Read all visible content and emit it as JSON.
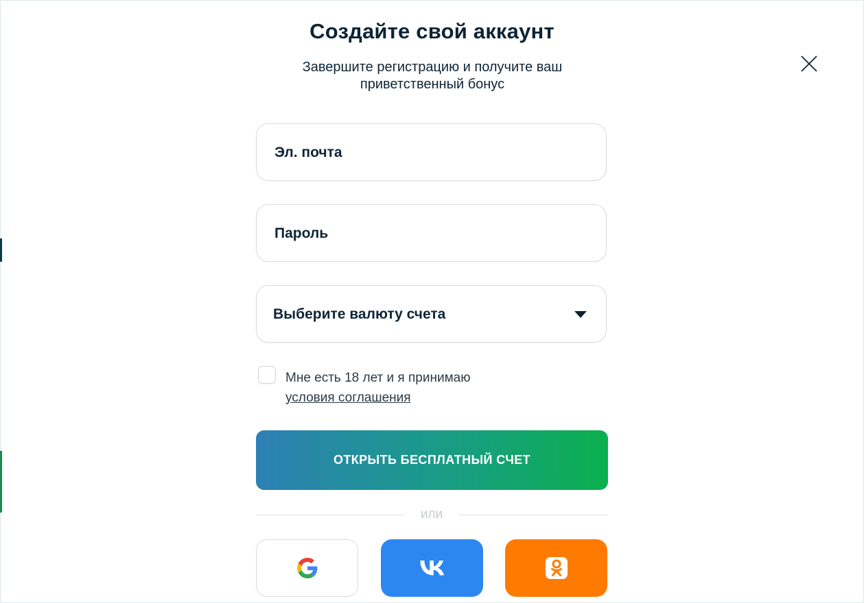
{
  "title": "Создайте свой аккаунт",
  "subtitle": "Завершите регистрацию и получите ваш приветственный бонус",
  "form": {
    "email_placeholder": "Эл. почта",
    "password_placeholder": "Пароль",
    "currency_label": "Выберите валюту счета",
    "agree_text": "Мне есть 18 лет и я принимаю",
    "agree_link": "условия соглашения",
    "submit_label": "ОТКРЫТЬ БЕСПЛАТНЫЙ СЧЕТ",
    "divider": "или"
  },
  "social": {
    "icons": [
      "google-icon",
      "vk-icon",
      "odnoklassniki-icon"
    ]
  },
  "colors": {
    "text": "#0d2436",
    "gradient_start": "#2d80b4",
    "gradient_end": "#0bb04e",
    "vk": "#2d87f0",
    "ok": "#ff7a00"
  }
}
